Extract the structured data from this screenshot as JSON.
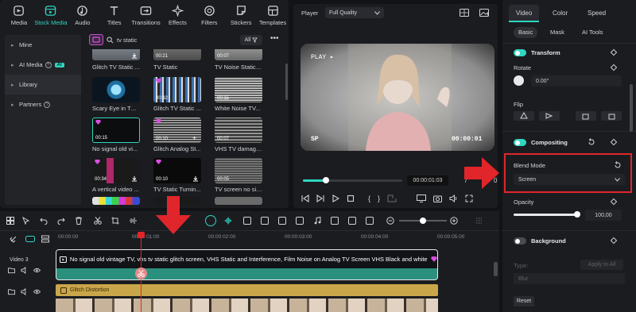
{
  "media_tabs": [
    {
      "label": "Media",
      "icon": "media-icon"
    },
    {
      "label": "Stock Media",
      "icon": "stock-media-icon",
      "active": true
    },
    {
      "label": "Audio",
      "icon": "audio-icon"
    },
    {
      "label": "Titles",
      "icon": "titles-icon"
    },
    {
      "label": "Transitions",
      "icon": "transitions-icon"
    },
    {
      "label": "Effects",
      "icon": "effects-icon"
    },
    {
      "label": "Filters",
      "icon": "filters-icon"
    },
    {
      "label": "Stickers",
      "icon": "stickers-icon"
    },
    {
      "label": "Templates",
      "icon": "templates-icon"
    }
  ],
  "library_nav": [
    {
      "label": "Mine"
    },
    {
      "label": "AI Media",
      "badge": "AI"
    },
    {
      "label": "Library"
    },
    {
      "label": "Partners"
    }
  ],
  "search": {
    "value": "tv static",
    "filter": "All"
  },
  "thumbnails": [
    {
      "label": "Glitch TV Static ...",
      "duration": ""
    },
    {
      "label": "TV Static",
      "duration": "00:21"
    },
    {
      "label": "TV Noise Static, ...",
      "duration": "00:07"
    },
    {
      "label": "Scary Eye in TV ...",
      "duration": ""
    },
    {
      "label": "Glitch TV Static ...",
      "duration": "00:32"
    },
    {
      "label": "White Noise TV...",
      "duration": "00:15"
    },
    {
      "label": "No signal old vi...",
      "duration": "00:15"
    },
    {
      "label": "Glitch Analog St...",
      "duration": "00:10"
    },
    {
      "label": "VHS TV damage...",
      "duration": "00:07"
    },
    {
      "label": "A vertical video ...",
      "duration": "00:34"
    },
    {
      "label": "TV Static Turnin...",
      "duration": "00:10"
    },
    {
      "label": "TV screen no sig...",
      "duration": "00:05"
    }
  ],
  "player": {
    "title": "Player",
    "quality": "Full Quality",
    "overlay_play": "PLAY ▸",
    "overlay_sp": "SP",
    "overlay_time": "00:00:01",
    "current_time": "00:00:01:03",
    "slash": "/",
    "total_time_partial": "0"
  },
  "props": {
    "tabs": [
      "Video",
      "Color",
      "Speed"
    ],
    "subtabs": [
      "Basic",
      "Mask",
      "AI Tools"
    ],
    "transform": "Transform",
    "rotate_label": "Rotate",
    "rotate_value": "0.00°",
    "flip_label": "Flip",
    "compositing": "Compositing",
    "blend_mode_label": "Blend Mode",
    "blend_mode_value": "Screen",
    "opacity_label": "Opacity",
    "opacity_value": "100,00",
    "opacity_level": 1.0,
    "background": "Background",
    "type_label": "Type:",
    "apply_all": "Apply to All",
    "blur_value": "Blur",
    "reset": "Reset"
  },
  "timeline": {
    "ticks": [
      "00:00:00",
      "00:00:01:00",
      "00:00:02:00",
      "00:00:03:00",
      "00:00:04:00",
      "00:00:05:00"
    ],
    "track_label": "Video 3",
    "clip_title": "No signal old vintage TV, vhs tv static glitch screen, VHS Static and Interference, Film Noise on Analog TV Screen VHS Black and white ...",
    "effect_clip": "Glitch Distortion"
  },
  "colors": {
    "accent": "#2fd6c0",
    "highlight_red": "#e0262b",
    "gem": "#d94fe0"
  }
}
